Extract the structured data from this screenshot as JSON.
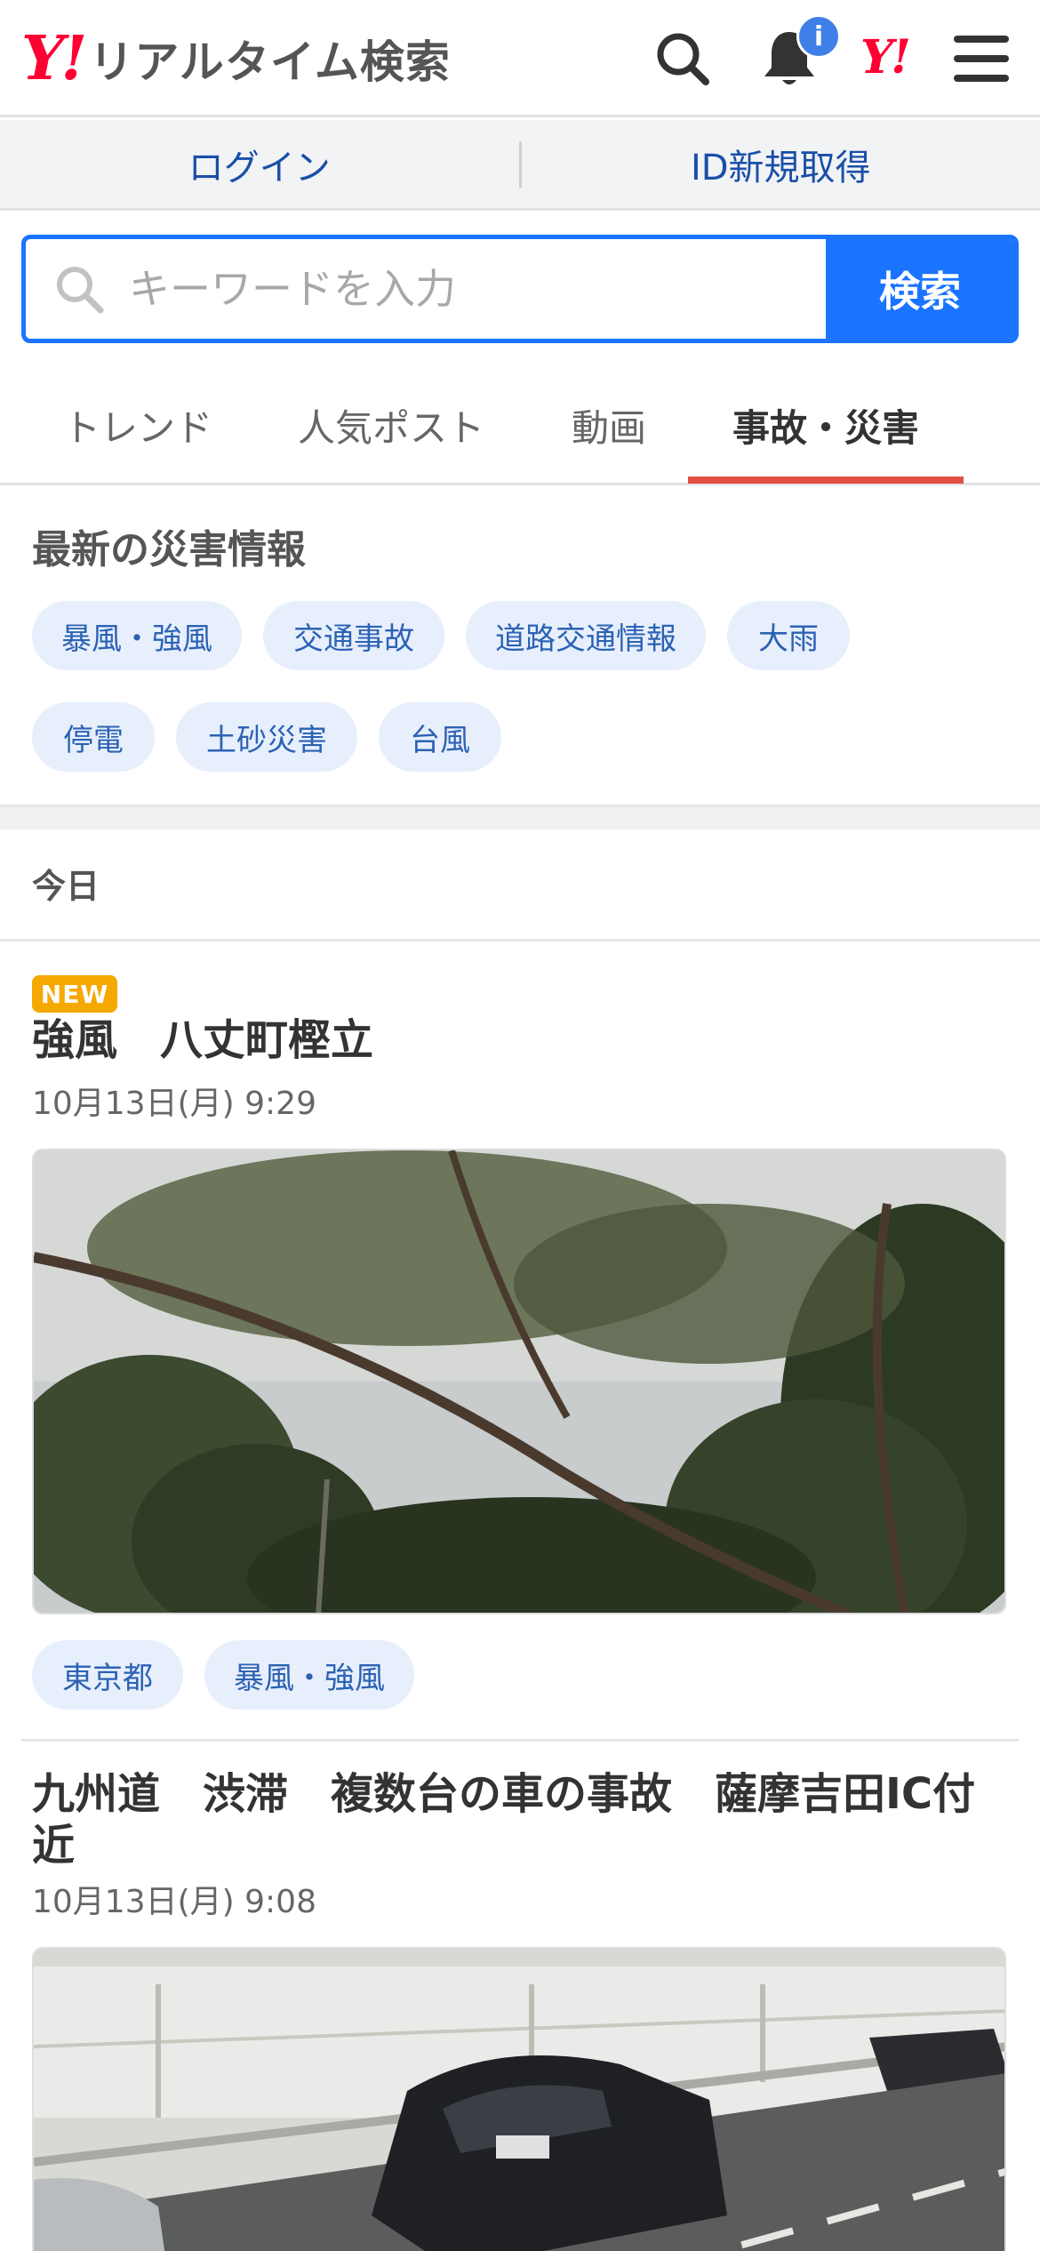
{
  "header": {
    "logo_mark": "Y!",
    "logo_text": "リアルタイム検索",
    "notification_badge": "i",
    "yahoo_mark": "Y!"
  },
  "loginbar": {
    "login": "ログイン",
    "register": "ID新規取得"
  },
  "search": {
    "placeholder": "キーワードを入力",
    "button": "検索"
  },
  "tabs": [
    {
      "label": "トレンド"
    },
    {
      "label": "人気ポスト"
    },
    {
      "label": "動画"
    },
    {
      "label": "事故・災害",
      "active": true
    }
  ],
  "disaster": {
    "title": "最新の災害情報",
    "tags": [
      "暴風・強風",
      "交通事故",
      "道路交通情報",
      "大雨",
      "停電",
      "土砂災害",
      "台風"
    ]
  },
  "timeline": {
    "date_heading": "今日"
  },
  "articles": [
    {
      "badge": "NEW",
      "title": "強風　八丈町樫立",
      "time": "10月13日(月) 9:29",
      "tags": [
        "東京都",
        "暴風・強風"
      ]
    },
    {
      "title_line1": "九州道　渋滞　複数台の車の事故　薩摩吉田IC付",
      "title_line2": "近",
      "time": "10月13日(月) 9:08"
    }
  ],
  "colors": {
    "brand_red": "#ff0033",
    "accent_blue": "#1a74ff",
    "tab_indicator": "#e24f44",
    "chip_bg": "#e7effc",
    "new_badge": "#f5a800"
  }
}
